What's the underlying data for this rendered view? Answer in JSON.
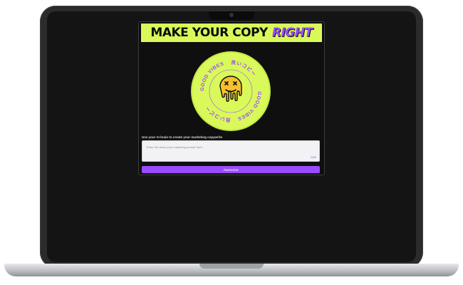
{
  "app": {
    "banner": {
      "title": "MAKE YOUR COPY",
      "highlight": "RIGHT"
    },
    "badge": {
      "ring_texts": [
        "GOOD VIBES",
        "良いコピー",
        "GOOD VIBES",
        "良いコピー"
      ],
      "icon": "melting-smiley-icon"
    },
    "prompt_label": "Use your AI brain to create your marketing copywrite",
    "input": {
      "placeholder": "Enter the about your marketing prompt here...",
      "count": "0/90"
    },
    "submit_label": "Awesome"
  },
  "colors": {
    "accent": "#d9f95a",
    "brand": "#9b4bff",
    "screen": "#141414"
  }
}
